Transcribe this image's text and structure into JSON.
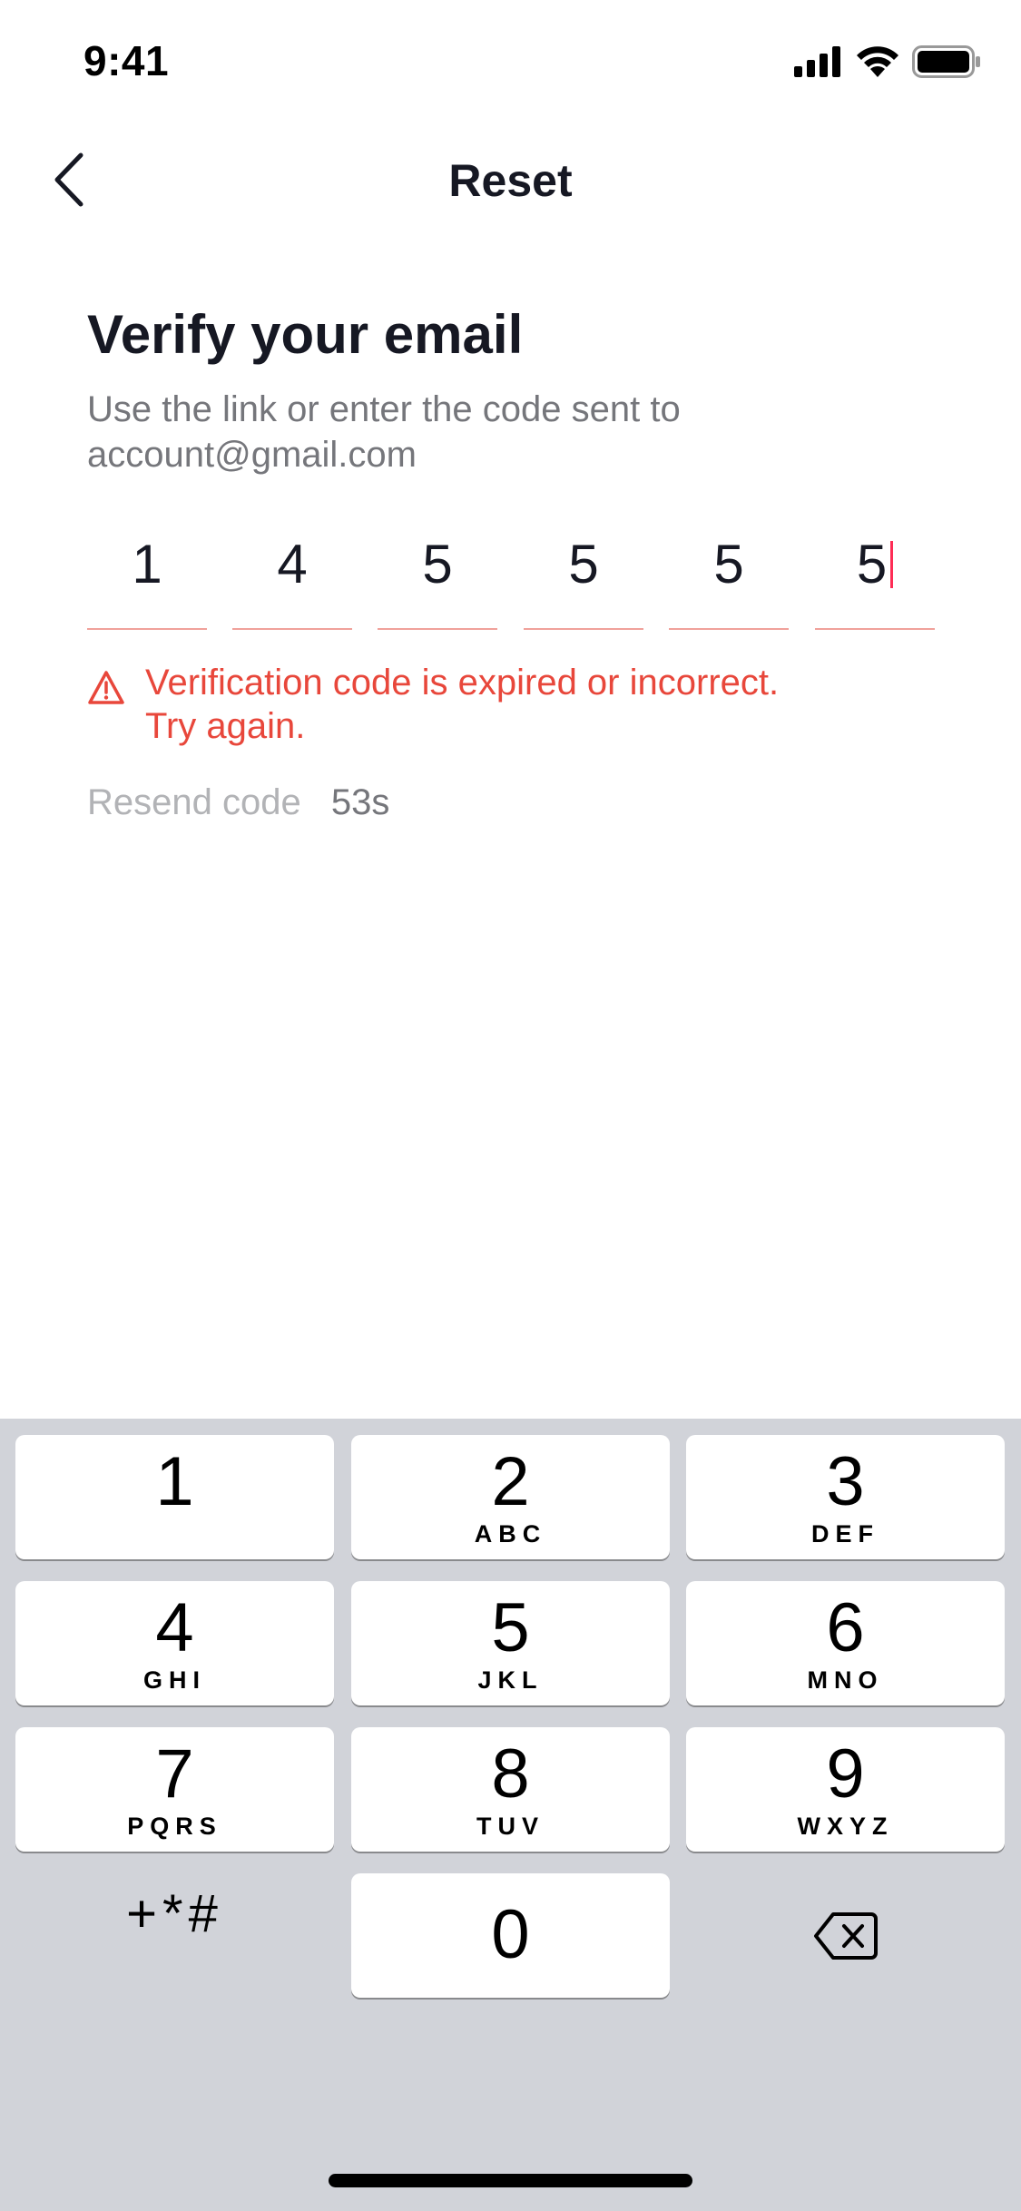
{
  "status_bar": {
    "time": "9:41",
    "icons": [
      "cellular-signal-icon",
      "wifi-icon",
      "battery-icon"
    ]
  },
  "nav": {
    "title": "Reset",
    "back_icon": "chevron-left-icon"
  },
  "content": {
    "heading": "Verify your email",
    "subtext_line1": "Use the link or enter the code sent to",
    "subtext_line2": "account@gmail.com",
    "code_digits": [
      "1",
      "4",
      "5",
      "5",
      "5",
      "5"
    ],
    "error_line1": "Verification code is expired or incorrect.",
    "error_line2": "Try again.",
    "error_icon": "warning-triangle-icon",
    "resend_label": "Resend code",
    "resend_timer": "53s"
  },
  "keyboard": {
    "keys": [
      {
        "digit": "1",
        "letters": ""
      },
      {
        "digit": "2",
        "letters": "ABC"
      },
      {
        "digit": "3",
        "letters": "DEF"
      },
      {
        "digit": "4",
        "letters": "GHI"
      },
      {
        "digit": "5",
        "letters": "JKL"
      },
      {
        "digit": "6",
        "letters": "MNO"
      },
      {
        "digit": "7",
        "letters": "PQRS"
      },
      {
        "digit": "8",
        "letters": "TUV"
      },
      {
        "digit": "9",
        "letters": "WXYZ"
      },
      {
        "digit": "0",
        "letters": ""
      }
    ],
    "symbols_label": "+*#",
    "delete_icon": "backspace-icon"
  },
  "colors": {
    "error": "#e8473b",
    "caret": "#fe2c55",
    "keyboard_background": "#d1d3d9"
  }
}
